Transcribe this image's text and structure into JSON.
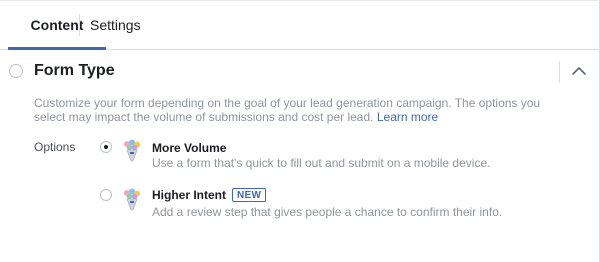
{
  "tabs": [
    {
      "label": "Content",
      "active": true
    },
    {
      "label": "Settings",
      "active": false
    }
  ],
  "section": {
    "title": "Form Type",
    "description_line1": "Customize your form depending on the goal of your lead generation campaign. The options you",
    "description_line2": "select may impact the volume of submissions and cost per lead.",
    "learn_more": "Learn more",
    "collapse_icon": "chevron-up-icon"
  },
  "options": {
    "label": "Options",
    "items": [
      {
        "title": "More Volume",
        "description": "Use a form that's quick to fill out and submit on a mobile device.",
        "selected": true,
        "icon": "bouquet-icon"
      },
      {
        "title": "Higher Intent",
        "badge": "NEW",
        "description": "Add a review step that gives people a chance to confirm their info.",
        "selected": false,
        "icon": "bouquet-icon"
      }
    ]
  },
  "colors": {
    "accent": "#4267b2",
    "muted_text": "#90949c",
    "border": "#dadde1"
  }
}
